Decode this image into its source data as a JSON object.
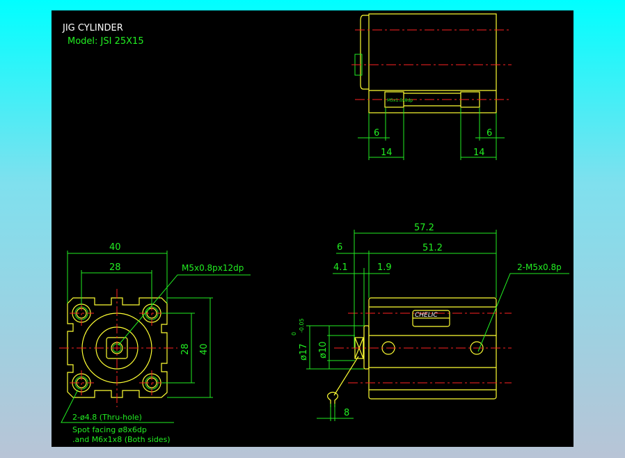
{
  "title": "JIG CYLINDER",
  "model": "Model:  JSI  25X15",
  "top_view": {
    "dim_left_6": "6",
    "dim_left_14": "14",
    "dim_right_6": "6",
    "dim_right_14": "14",
    "thread_label": "M5x1.0x8dp"
  },
  "front_view": {
    "dim_width_40": "40",
    "dim_width_28": "28",
    "dim_height_28": "28",
    "dim_height_40": "40",
    "thread_leader": "M5x0.8px12dp",
    "note_line1": "2-ø4.8 (Thru-hole)",
    "note_line2": "Spot facing  ø8x6dp",
    "note_line3": ".and M6x1x8  (Both sides)"
  },
  "side_view": {
    "dim_57_2": "57.2",
    "dim_51_2": "51.2",
    "dim_6": "6",
    "dim_4_1": "4.1",
    "dim_1_9": "1.9",
    "dim_d17": "ø17",
    "tol_upper": "0",
    "tol_lower": "-0.05",
    "dim_d10": "ø10",
    "dim_8": "8",
    "port_leader": "2-M5x0.8p",
    "brand_label": "CHELIC"
  },
  "colors": {
    "outline": "#ffff33",
    "dimension": "#22ee22",
    "centerline": "#ff2222",
    "background": "#000000"
  }
}
